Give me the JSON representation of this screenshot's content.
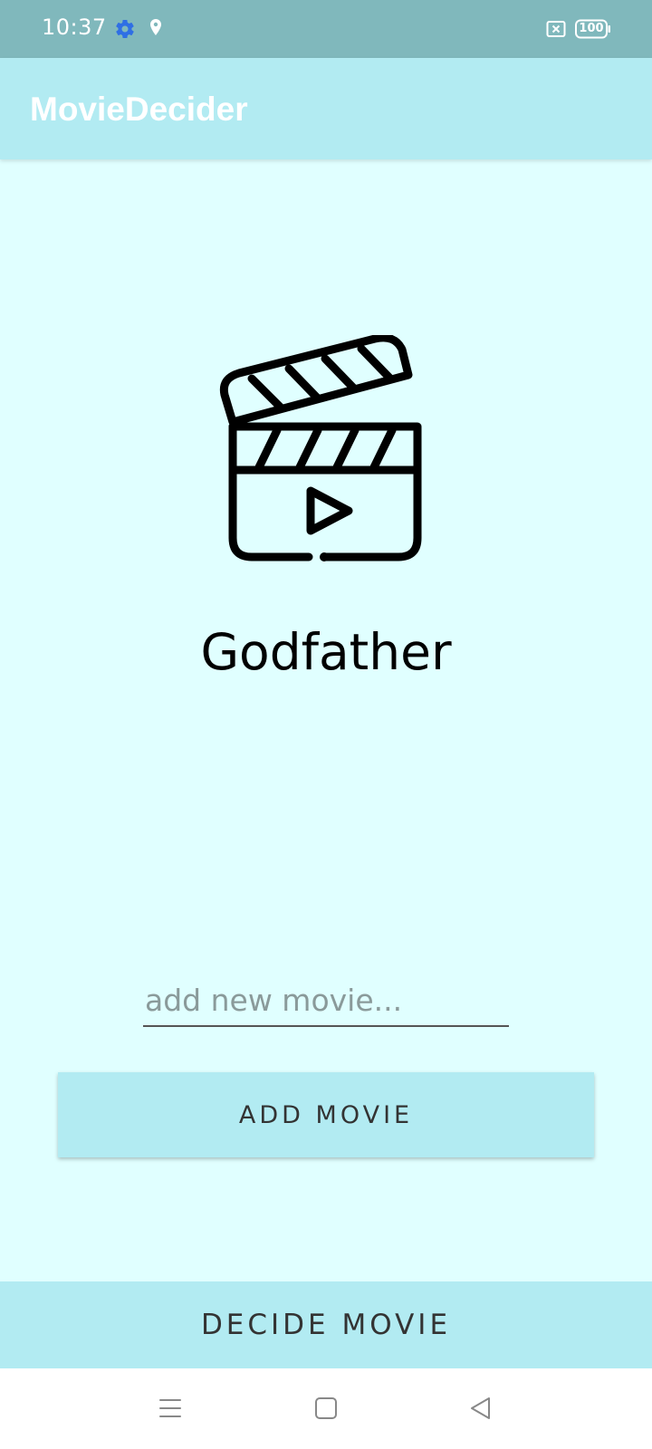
{
  "status_bar": {
    "time": "10:37",
    "battery": "100",
    "icons": [
      "settings-gear-icon",
      "location-pin-icon",
      "sim-x-icon",
      "battery-icon"
    ]
  },
  "app_bar": {
    "title": "MovieDecider"
  },
  "main": {
    "image_icon": "movie-clapperboard-icon",
    "current_movie": "Godfather",
    "input_placeholder": "add new movie...",
    "input_value": "",
    "add_button_label": "ADD MOVIE"
  },
  "bottom": {
    "decide_button_label": "DECIDE MOVIE"
  },
  "nav_bar": {
    "icons": [
      "menu-icon",
      "home-icon",
      "back-icon"
    ]
  },
  "colors": {
    "status_bar": "#80b8bc",
    "app_bar": "#b2ebf2",
    "background": "#e0ffff",
    "button": "#b2ebf2",
    "title_text": "#ffffff"
  }
}
